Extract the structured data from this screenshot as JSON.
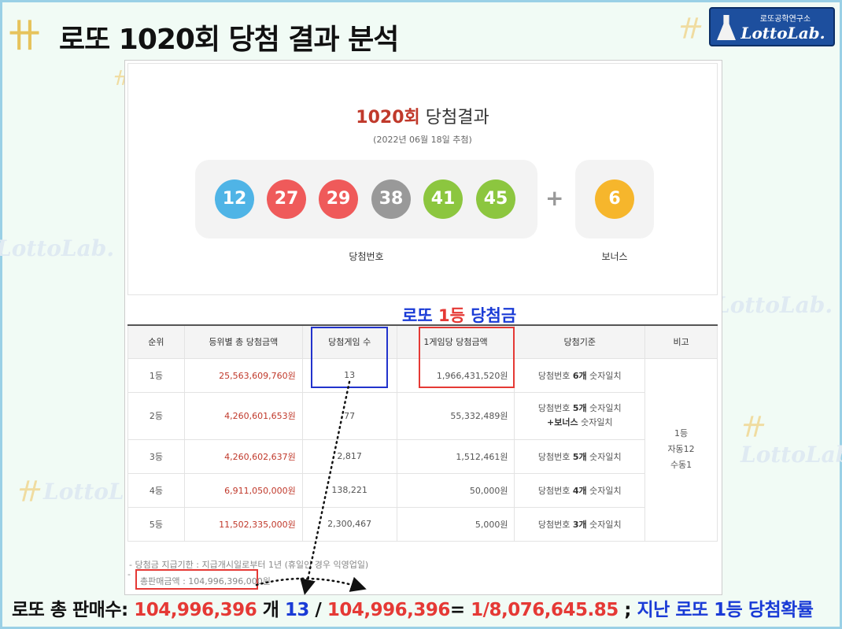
{
  "header": {
    "title": "로또 1020회 당첨 결과 분석",
    "icon": "lotto-lab-emblem-icon"
  },
  "brand": {
    "subtitle": "로또공학연구소",
    "name": "LottoLab."
  },
  "watermark": {
    "text": "LottoLab."
  },
  "draw": {
    "number": "1020회",
    "heading_suffix": "당첨결과",
    "date": "(2022년 06월 18일 추첨)",
    "balls": [
      {
        "value": "12",
        "color": "#4fb4e6"
      },
      {
        "value": "27",
        "color": "#ef5a5a"
      },
      {
        "value": "29",
        "color": "#ef5a5a"
      },
      {
        "value": "38",
        "color": "#999999"
      },
      {
        "value": "41",
        "color": "#8cc63f"
      },
      {
        "value": "45",
        "color": "#8cc63f"
      }
    ],
    "plus": "+",
    "bonus": {
      "value": "6",
      "color": "#f6b62c"
    },
    "label_winning": "당첨번호",
    "label_bonus": "보너스"
  },
  "callout": {
    "part1": "로또 ",
    "part2": "1등",
    "part3": " 당첨금"
  },
  "table": {
    "headers": [
      "순위",
      "등위별 총 당첨금액",
      "당첨게임 수",
      "1게임당 당첨금액",
      "당첨기준",
      "비고"
    ],
    "rows": [
      {
        "rank": "1등",
        "total": "25,563,609,760원",
        "winners": "13",
        "per": "1,966,431,520원",
        "crit_a": "당첨번호 ",
        "crit_b": "6개",
        "crit_c": " 숫자일치"
      },
      {
        "rank": "2등",
        "total": "4,260,601,653원",
        "winners": "77",
        "per": "55,332,489원",
        "crit_a": "당첨번호 ",
        "crit_b": "5개",
        "crit_c": " 숫자일치",
        "crit_line2_b": "+보너스",
        "crit_line2_c": " 숫자일치"
      },
      {
        "rank": "3등",
        "total": "4,260,602,637원",
        "winners": "2,817",
        "per": "1,512,461원",
        "crit_a": "당첨번호 ",
        "crit_b": "5개",
        "crit_c": " 숫자일치"
      },
      {
        "rank": "4등",
        "total": "6,911,050,000원",
        "winners": "138,221",
        "per": "50,000원",
        "crit_a": "당첨번호 ",
        "crit_b": "4개",
        "crit_c": " 숫자일치"
      },
      {
        "rank": "5등",
        "total": "11,502,335,000원",
        "winners": "2,300,467",
        "per": "5,000원",
        "crit_a": "당첨번호 ",
        "crit_b": "3개",
        "crit_c": " 숫자일치"
      }
    ],
    "note_lines": [
      "1등",
      "자동12",
      "수동1"
    ]
  },
  "notes": {
    "deadline": "-  당첨금 지급기한 : 지급개시일로부터 1년 (휴일인 경우 익영업일)",
    "sales_prefix": "-",
    "sales": "총판매금액 : 104,996,396,000원"
  },
  "formula": {
    "label": "로또 총 판매수: ",
    "sales_count": "104,996,396",
    "unit": " 개  ",
    "winners": "13",
    "slash": " / ",
    "divisor": "104,996,396",
    "equals": "=  ",
    "ratio": "1/8,076,645.85",
    "sep": " ; ",
    "caption": "지난 로또 1등 당첨확률"
  }
}
